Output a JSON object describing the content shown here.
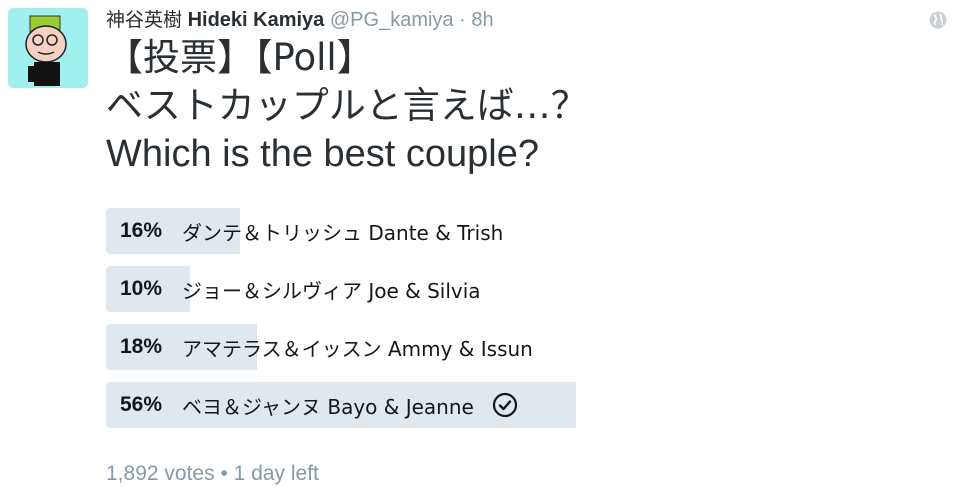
{
  "tweet": {
    "display_name_jp": "神谷英樹",
    "display_name_en": "Hideki Kamiya",
    "handle": "@PG_kamiya",
    "separator": "·",
    "time": "8h",
    "text_line1": "【投票】【Poll】",
    "text_line2": "ベストカップルと言えば…？",
    "text_line3": "Which is the best couple?"
  },
  "poll": {
    "choices": [
      {
        "percent": "16%",
        "label": "ダンテ＆トリッシュ Dante & Trish",
        "fraction": 0.16,
        "winner": false
      },
      {
        "percent": "10%",
        "label": "ジョー＆シルヴィア Joe & Silvia",
        "fraction": 0.1,
        "winner": false
      },
      {
        "percent": "18%",
        "label": "アマテラス＆イッスン Ammy & Issun",
        "fraction": 0.18,
        "winner": false
      },
      {
        "percent": "56%",
        "label": "ベヨ＆ジャンヌ Bayo & Jeanne",
        "fraction": 0.56,
        "winner": true
      }
    ],
    "votes": "1,892 votes",
    "bullet": "•",
    "time_left": "1 day left"
  },
  "colors": {
    "bar": "#e1e8ed",
    "avatar_bg": "#9ff0ee",
    "muted": "#8899a6",
    "text": "#292f33"
  },
  "icons": {
    "globe": "globe-icon",
    "winner": "check-circle-icon"
  }
}
